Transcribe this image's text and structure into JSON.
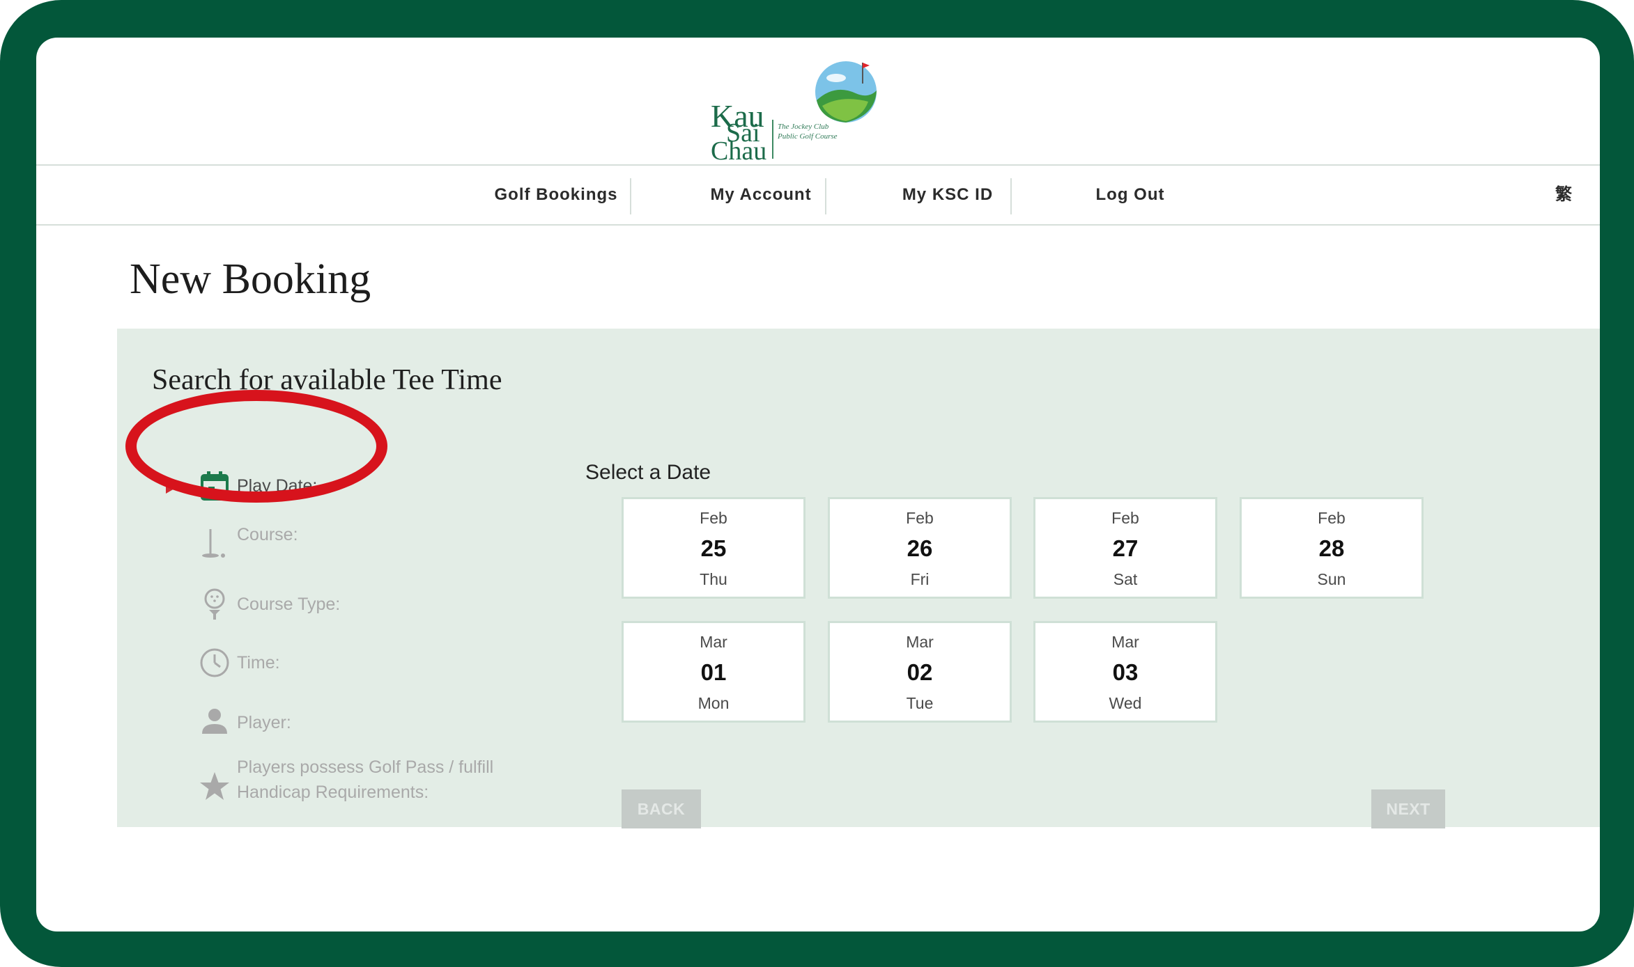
{
  "brand": {
    "name_lines": [
      "Kau",
      "Sai",
      "Chau"
    ],
    "subtitle": "The Jockey Club Public Golf Course"
  },
  "nav": {
    "items": [
      "Golf Bookings",
      "My Account",
      "My KSC ID",
      "Log Out"
    ],
    "language_toggle": "繁"
  },
  "page": {
    "title": "New Booking"
  },
  "search": {
    "title": "Search for available Tee Time",
    "steps": [
      {
        "label": "Play Date:",
        "icon": "calendar-icon",
        "active": true
      },
      {
        "label": "Course:",
        "icon": "golf-flag-icon",
        "active": false
      },
      {
        "label": "Course Type:",
        "icon": "golf-ball-tee-icon",
        "active": false
      },
      {
        "label": "Time:",
        "icon": "clock-icon",
        "active": false
      },
      {
        "label": "Player:",
        "icon": "person-icon",
        "active": false
      },
      {
        "label": "Players possess Golf Pass / fulfill Handicap Requirements:",
        "icon": "star-icon",
        "active": false
      }
    ]
  },
  "date_picker": {
    "title": "Select a Date",
    "dates": [
      {
        "month": "Feb",
        "day": "25",
        "weekday": "Thu"
      },
      {
        "month": "Feb",
        "day": "26",
        "weekday": "Fri"
      },
      {
        "month": "Feb",
        "day": "27",
        "weekday": "Sat"
      },
      {
        "month": "Feb",
        "day": "28",
        "weekday": "Sun"
      },
      {
        "month": "Mar",
        "day": "01",
        "weekday": "Mon"
      },
      {
        "month": "Mar",
        "day": "02",
        "weekday": "Tue"
      },
      {
        "month": "Mar",
        "day": "03",
        "weekday": "Wed"
      }
    ]
  },
  "buttons": {
    "back": "BACK",
    "next": "NEXT"
  },
  "colors": {
    "frame": "#03573a",
    "panel": "#e3ede6",
    "accent_green": "#1c7a4c",
    "highlight_red": "#d7131c",
    "disabled_button": "#c5cbc8"
  }
}
